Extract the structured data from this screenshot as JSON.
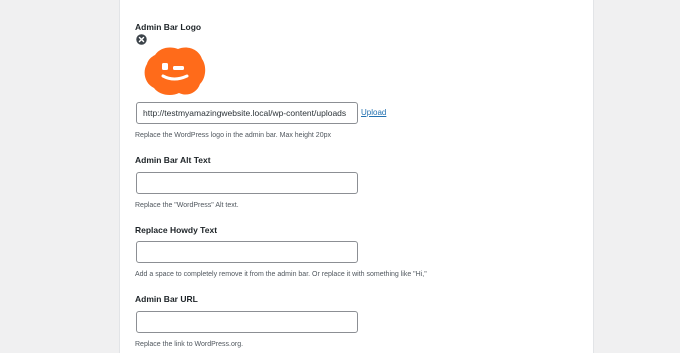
{
  "admin_bar_logo": {
    "label": "Admin Bar Logo",
    "url_value": "http://testmyamazingwebsite.local/wp-content/uploads",
    "upload_label": "Upload",
    "description": "Replace the WordPress logo in the admin bar. Max height 20px",
    "logo_color": "#ff6b1a"
  },
  "admin_bar_alt_text": {
    "label": "Admin Bar Alt Text",
    "value": "",
    "description": "Replace the \"WordPress\" Alt text."
  },
  "replace_howdy_text": {
    "label": "Replace Howdy Text",
    "value": "",
    "description": "Add a space to completely remove it from the admin bar. Or replace it with something like \"Hi,\""
  },
  "admin_bar_url": {
    "label": "Admin Bar URL",
    "value": "",
    "description": "Replace the link to WordPress.org."
  }
}
